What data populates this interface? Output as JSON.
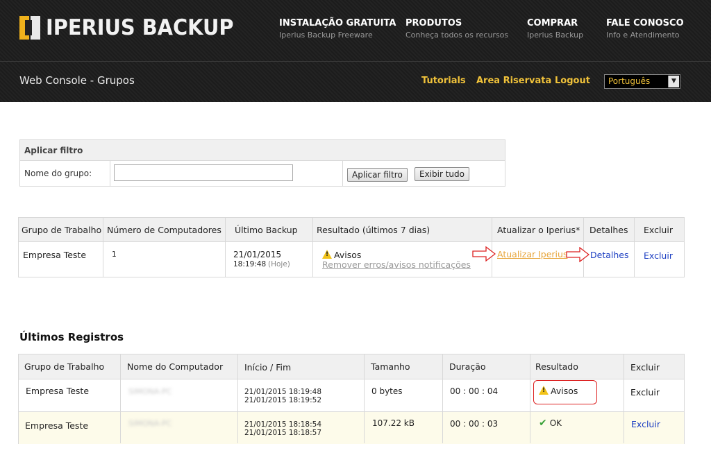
{
  "brand": {
    "name": "IPERIUS BACKUP"
  },
  "topnav": [
    {
      "title": "INSTALAÇÃO GRATUITA",
      "subtitle": "Iperius Backup Freeware"
    },
    {
      "title": "PRODUTOS",
      "subtitle": "Conheça todos os recursos"
    },
    {
      "title": "COMPRAR",
      "subtitle": "Iperius Backup"
    },
    {
      "title": "FALE CONOSCO",
      "subtitle": "Info e Atendimento"
    }
  ],
  "subheader": {
    "title": "Web Console - Grupos",
    "links": [
      "Tutorials",
      "Area Riservata",
      "Logout"
    ],
    "language": "Português"
  },
  "filter": {
    "header": "Aplicar filtro",
    "label": "Nome do grupo:",
    "input_value": "",
    "apply_button": "Aplicar filtro",
    "show_all_button": "Exibir tudo"
  },
  "groups_table": {
    "columns": [
      "Grupo de Trabalho",
      "Número de Computadores",
      "Último Backup",
      "Resultado (últimos 7 dias)",
      "Atualizar o Iperius*",
      "Detalhes",
      "Excluir"
    ],
    "rows": [
      {
        "group": "Empresa Teste",
        "computers": "1",
        "last_backup_date": "21/01/2015",
        "last_backup_time": "18:19:48",
        "last_backup_when": "(Hoje)",
        "result": "Avisos",
        "remove_link": "Remover erros/avisos notificações",
        "update_link": "Atualizar Iperius",
        "details_link": "Detalhes",
        "delete_link": "Excluir"
      }
    ]
  },
  "logs": {
    "title": "Últimos Registros",
    "columns": [
      "Grupo de Trabalho",
      "Nome do Computador",
      "Início / Fim",
      "Tamanho",
      "Duração",
      "Resultado",
      "Excluir"
    ],
    "rows": [
      {
        "group": "Empresa Teste",
        "computer": "SIMONA-PC",
        "start": "21/01/2015 18:19:48",
        "end": "21/01/2015 18:19:52",
        "size": "0 bytes",
        "duration": "00 : 00 : 04",
        "result": "Avisos",
        "delete": "Excluir"
      },
      {
        "group": "Empresa Teste",
        "computer": "SIMONA-PC",
        "start": "21/01/2015 18:18:54",
        "end": "21/01/2015 18:18:57",
        "size": "107.22 kB",
        "duration": "00 : 00 : 03",
        "result": "OK",
        "delete": "Excluir"
      }
    ]
  },
  "colors": {
    "accent_yellow": "#f0c23a",
    "link_blue": "#1d3fc2",
    "warning": "#f2c318",
    "ok_green": "#3aa23a",
    "highlight_red": "#dd2222"
  }
}
